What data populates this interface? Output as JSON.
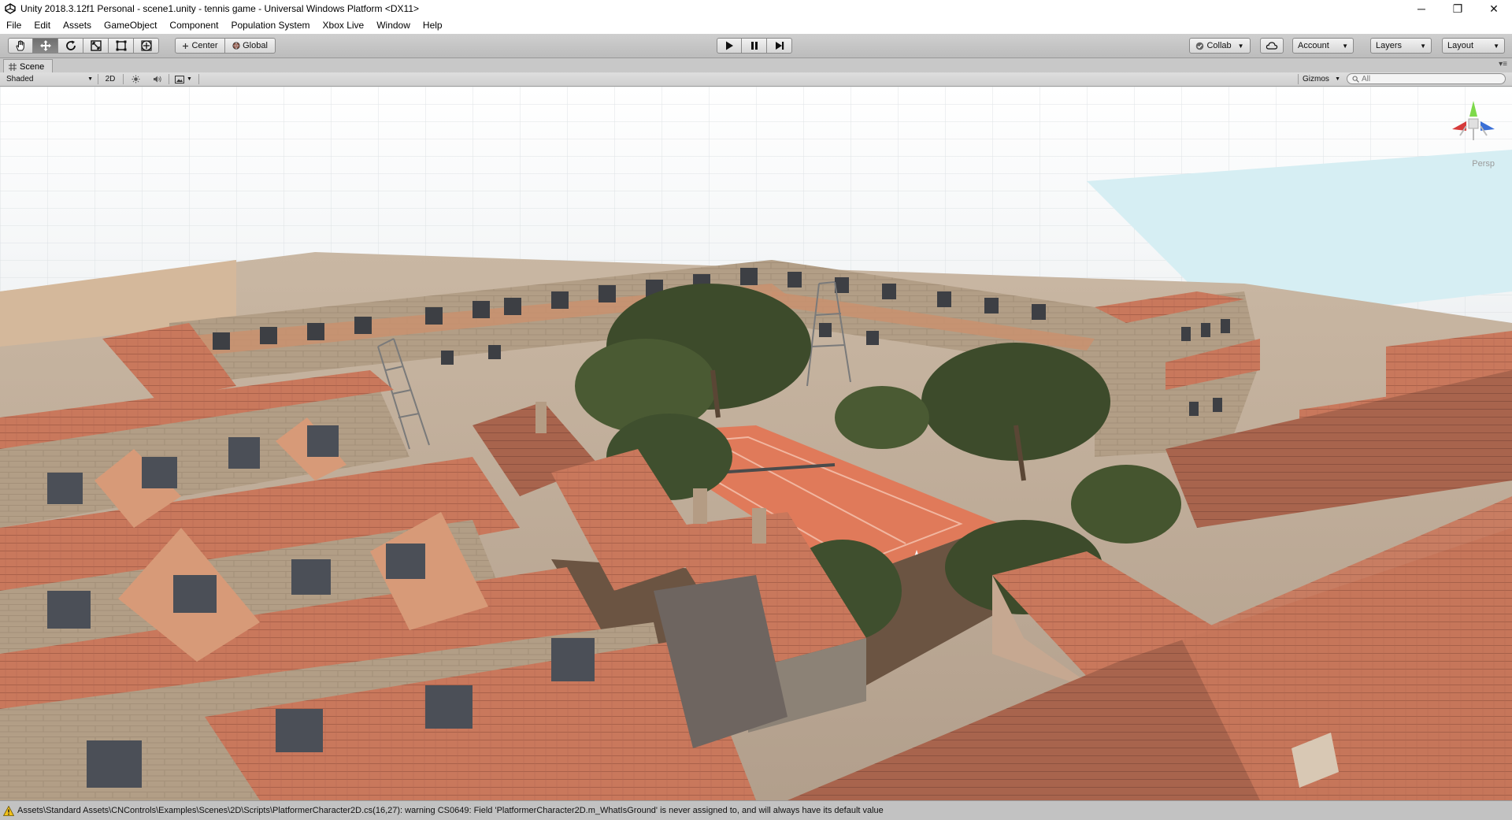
{
  "window": {
    "title": "Unity 2018.3.12f1 Personal - scene1.unity - tennis game - Universal Windows Platform <DX11>",
    "minimize": "─",
    "maximize": "❐",
    "close": "✕"
  },
  "menu": [
    "File",
    "Edit",
    "Assets",
    "GameObject",
    "Component",
    "Population System",
    "Xbox Live",
    "Window",
    "Help"
  ],
  "toolbar": {
    "tools": [
      "hand-tool",
      "move-tool",
      "rotate-tool",
      "scale-tool",
      "rect-tool",
      "transform-tool"
    ],
    "active_tool": "move-tool",
    "pivot_label": "Center",
    "space_label": "Global",
    "collab_label": "Collab",
    "account_label": "Account",
    "layers_label": "Layers",
    "layout_label": "Layout"
  },
  "scene": {
    "tab_label": "Scene",
    "shading_mode": "Shaded",
    "toggle_2d": "2D",
    "gizmos_label": "Gizmos",
    "search_placeholder": "All",
    "persp_label": "Persp"
  },
  "status": {
    "message": "Assets\\Standard Assets\\CNControls\\Examples\\Scenes\\2D\\Scripts\\PlatformerCharacter2D.cs(16,27): warning CS0649: Field 'PlatformerCharacter2D.m_WhatIsGround' is never assigned to, and will always have its default value"
  },
  "colors": {
    "roof": "#c9785c",
    "roof_dark": "#9a5a45",
    "wall": "#b7a289",
    "wall_shadow": "#6e6560",
    "court": "#e07a5a",
    "tree": "#3d4b2b",
    "ground": "#6b5442"
  }
}
